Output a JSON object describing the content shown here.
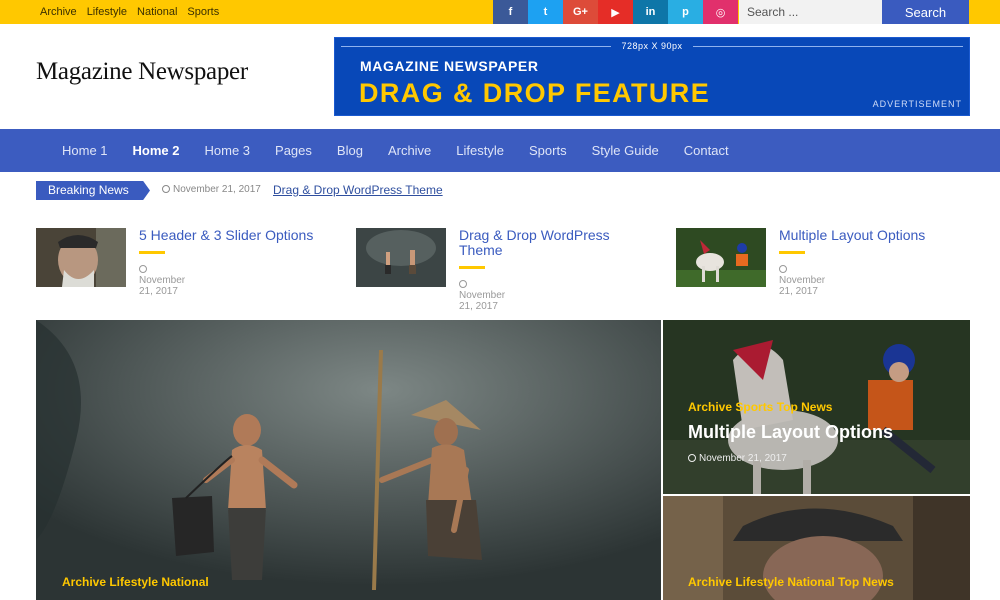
{
  "topbar": {
    "links": [
      "Archive",
      "Lifestyle",
      "National",
      "Sports"
    ],
    "social": [
      {
        "icon": "facebook-icon",
        "glyph": "f",
        "color": "#3b5998"
      },
      {
        "icon": "twitter-icon",
        "glyph": "t",
        "color": "#1da1f2"
      },
      {
        "icon": "google-plus-icon",
        "glyph": "G+",
        "color": "#dd4b39"
      },
      {
        "icon": "youtube-icon",
        "glyph": "▶",
        "color": "#e52d27"
      },
      {
        "icon": "linkedin-icon",
        "glyph": "in",
        "color": "#0e76a8"
      },
      {
        "icon": "pinterest-icon",
        "glyph": "p",
        "color": "#29aee3"
      },
      {
        "icon": "instagram-icon",
        "glyph": "◎",
        "color": "#e1306c"
      }
    ],
    "search_placeholder": "Search ...",
    "search_label": "Search"
  },
  "header": {
    "logo": "Magazine Newspaper",
    "ad": {
      "size": "728px X 90px",
      "title": "MAGAZINE NEWSPAPER",
      "headline": "DRAG & DROP FEATURE",
      "label": "ADVERTISEMENT"
    }
  },
  "nav": {
    "items": [
      "Home 1",
      "Home 2",
      "Home 3",
      "Pages",
      "Blog",
      "Archive",
      "Lifestyle",
      "Sports",
      "Style Guide",
      "Contact"
    ],
    "active": "Home 2"
  },
  "breaking": {
    "label": "Breaking News",
    "date": "November 21, 2017",
    "title": "Drag & Drop WordPress Theme"
  },
  "posts": [
    {
      "title": "5 Header & 3 Slider Options",
      "date": "November 21, 2017"
    },
    {
      "title": "Drag & Drop WordPress Theme",
      "date": "November 21, 2017"
    },
    {
      "title": "Multiple Layout Options",
      "date": "November 21, 2017"
    }
  ],
  "featured": {
    "main": {
      "categories": "Archive Lifestyle National"
    },
    "side1": {
      "categories": "Archive Sports Top News",
      "title": "Multiple Layout Options",
      "date": "November 21, 2017"
    },
    "side2": {
      "categories": "Archive Lifestyle National Top News"
    }
  },
  "colors": {
    "accent_yellow": "#ffc800",
    "brand_blue": "#3a5bbf",
    "ad_blue": "#0848b8"
  }
}
